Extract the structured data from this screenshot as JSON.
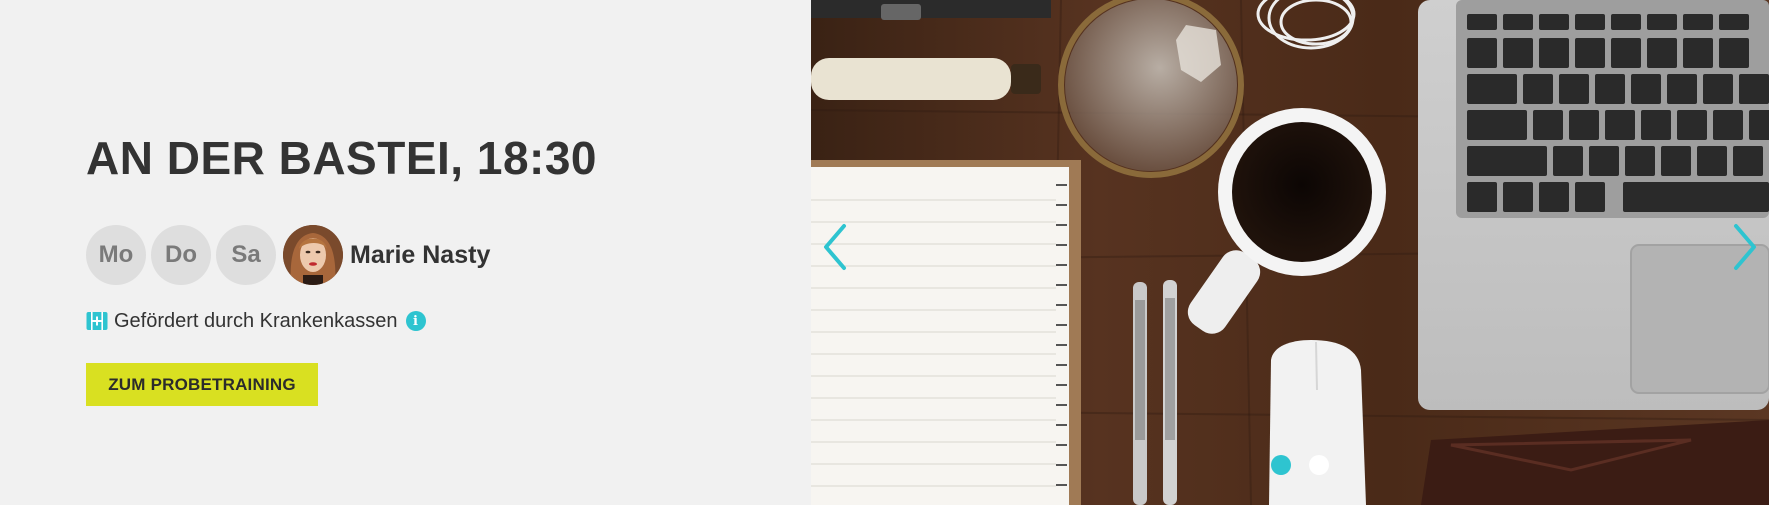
{
  "course": {
    "title": "AN DER BASTEI, 18:30",
    "days": [
      "Mo",
      "Do",
      "Sa"
    ],
    "trainer_name": "Marie Nasty",
    "funding_text": "Gefördert durch Krankenkassen",
    "info_symbol": "i",
    "cta_label": "ZUM PROBETRAINING"
  },
  "slider": {
    "slide_count": 2,
    "active_slide": 1,
    "icons": {
      "prev": "chevron-left-icon",
      "next": "chevron-right-icon"
    }
  },
  "colors": {
    "accent_teal": "#2ec4d0",
    "cta_yellow": "#d9e021",
    "text_dark": "#333333",
    "chip_bg": "#dedede",
    "chip_text": "#7a7a7a",
    "panel_bg": "#f1f1f1"
  }
}
